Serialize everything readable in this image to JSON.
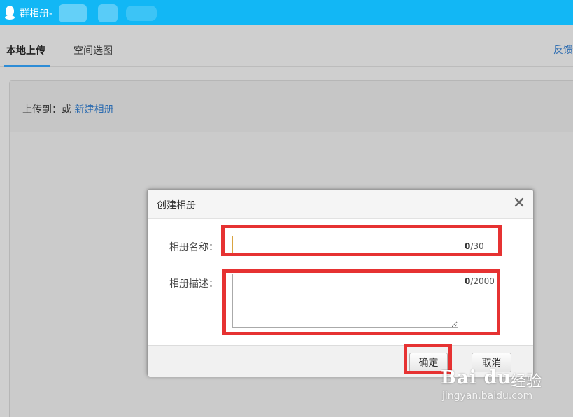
{
  "window": {
    "title": "群相册-"
  },
  "tabs": [
    {
      "label": "本地上传",
      "active": true
    },
    {
      "label": "空间选图",
      "active": false
    }
  ],
  "feedback_label": "反馈",
  "upload_section": {
    "prefix": "上传到：或 ",
    "new_album_link": "新建相册"
  },
  "dialog": {
    "title": "创建相册",
    "close_icon": "close-icon",
    "name_label": "相册名称：",
    "name_value": "",
    "name_count": "0",
    "name_max": "/30",
    "desc_label": "相册描述：",
    "desc_value": "",
    "desc_count": "0",
    "desc_max": "/2000",
    "ok_label": "确定",
    "cancel_label": "取消"
  },
  "watermark": {
    "logo": "Bai du",
    "site": "经验",
    "url": "jingyan.baidu.com"
  },
  "colors": {
    "title_bar": "#12b7f5",
    "link": "#2b6bb0",
    "highlight": "#e63232",
    "tab_underline": "#2d8cd6"
  }
}
